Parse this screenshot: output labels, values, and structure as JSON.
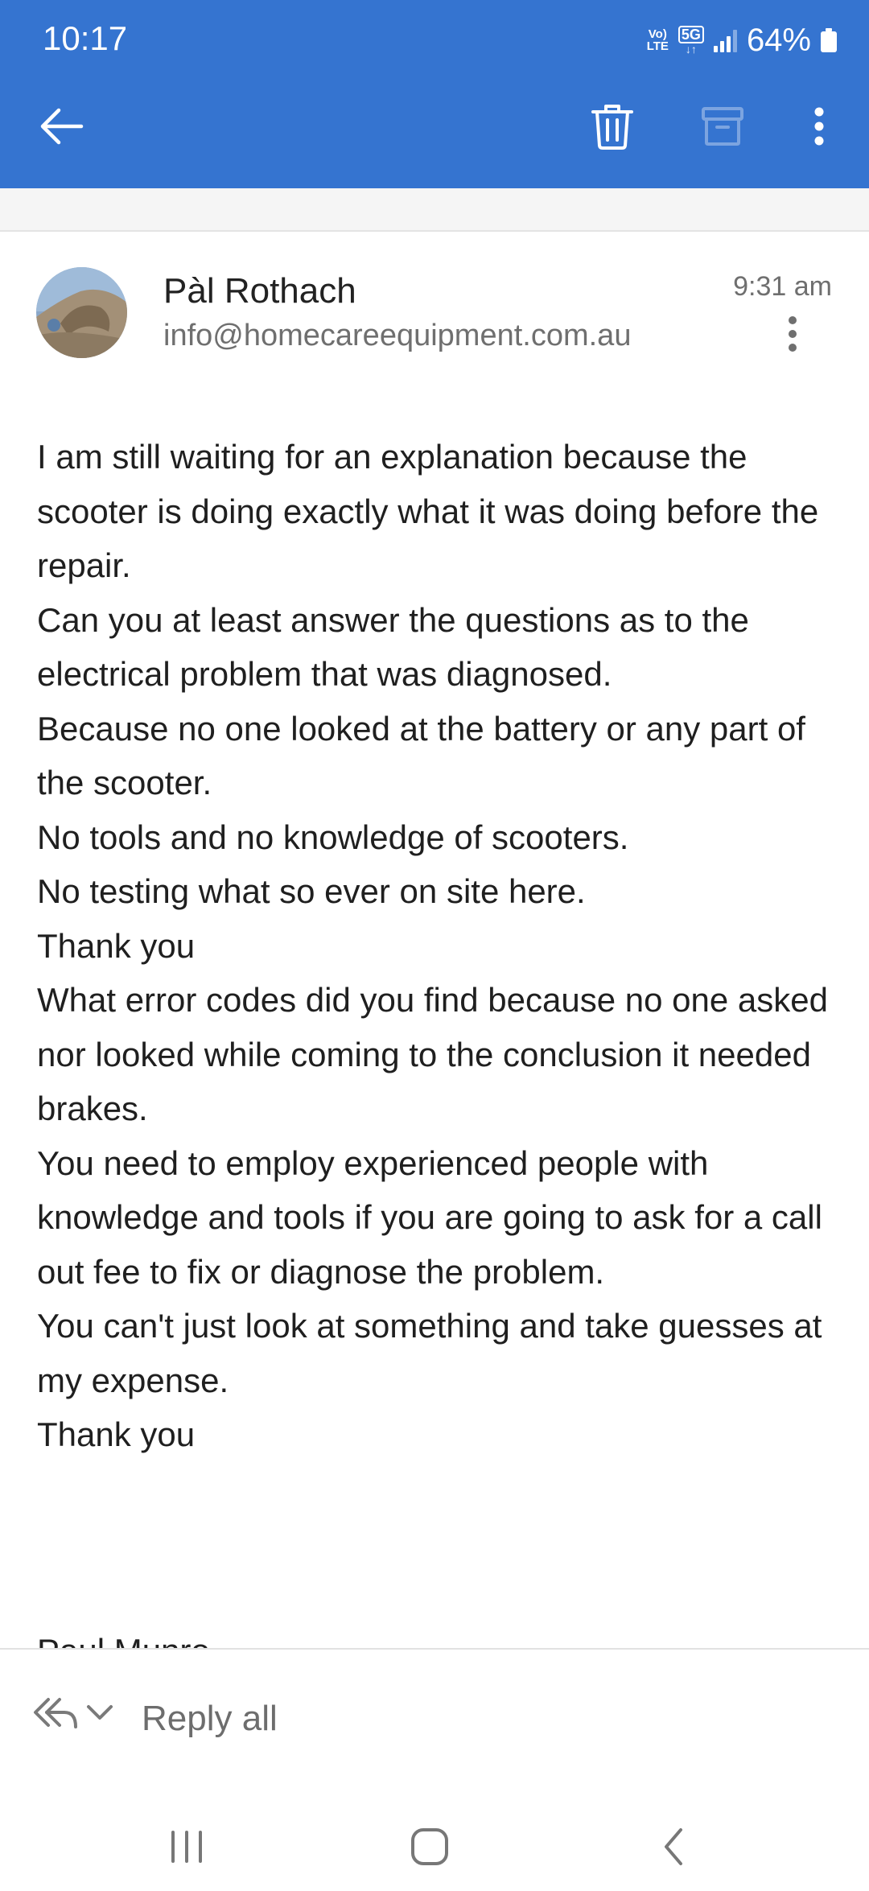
{
  "status_bar": {
    "time": "10:17",
    "volte": "Vo)\nLTE",
    "network": "5G",
    "battery": "64%"
  },
  "appbar": {
    "color": "#3574d0",
    "back_icon": "arrow-left-icon",
    "delete_icon": "trash-icon",
    "archive_icon": "archive-icon",
    "more_icon": "more-vertical-icon"
  },
  "message": {
    "sender_name": "Pàl Rothach",
    "sender_email": "info@homecareequipment.com.au",
    "time": "9:31 am",
    "body_lines": [
      "I am still waiting for an explanation because the scooter is doing exactly what it was doing before the repair.",
      "Can you at least answer the questions as to the electrical problem that was diagnosed.",
      "Because no one looked at the battery or any part of the scooter.",
      "No tools and no knowledge of scooters.",
      "No testing what so ever on site here.",
      "Thank you",
      "What error codes did you find because no one asked nor looked while coming to the conclusion it needed brakes.",
      "You need to employ experienced people with knowledge and tools if you are going to ask for a call out fee to fix or diagnose the problem.",
      "You can't just look at something and take guesses at my expense.",
      "Thank you"
    ],
    "signature_partial": "Paul Munro"
  },
  "reply_bar": {
    "label": "Reply all",
    "icon": "reply-all-icon"
  },
  "nav_bar": {
    "recents_icon": "recents-icon",
    "home_icon": "home-icon",
    "back_icon": "nav-back-icon"
  }
}
